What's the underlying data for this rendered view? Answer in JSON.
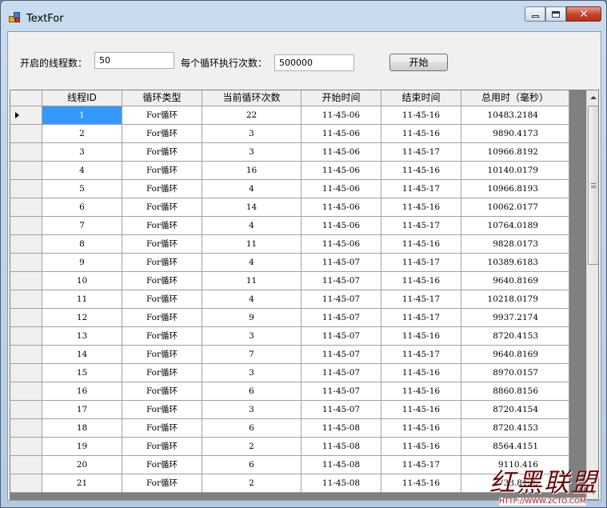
{
  "window": {
    "title": "TextFor"
  },
  "form": {
    "threads_label": "开启的线程数：",
    "threads_value": "50",
    "loops_label": "每个循环执行次数：",
    "loops_value": "500000",
    "start_button": "开始"
  },
  "grid": {
    "columns": [
      "线程ID",
      "循环类型",
      "当前循环次数",
      "开始时间",
      "结束时间",
      "总用时（毫秒）"
    ],
    "rows": [
      [
        "1",
        "For循环",
        "22",
        "11-45-06",
        "11-45-16",
        "10483.2184"
      ],
      [
        "2",
        "For循环",
        "3",
        "11-45-06",
        "11-45-16",
        "9890.4173"
      ],
      [
        "3",
        "For循环",
        "3",
        "11-45-06",
        "11-45-17",
        "10966.8192"
      ],
      [
        "4",
        "For循环",
        "16",
        "11-45-06",
        "11-45-16",
        "10140.0179"
      ],
      [
        "5",
        "For循环",
        "4",
        "11-45-06",
        "11-45-17",
        "10966.8193"
      ],
      [
        "6",
        "For循环",
        "14",
        "11-45-06",
        "11-45-16",
        "10062.0177"
      ],
      [
        "7",
        "For循环",
        "4",
        "11-45-06",
        "11-45-17",
        "10764.0189"
      ],
      [
        "8",
        "For循环",
        "11",
        "11-45-06",
        "11-45-16",
        "9828.0173"
      ],
      [
        "9",
        "For循环",
        "4",
        "11-45-07",
        "11-45-17",
        "10389.6183"
      ],
      [
        "10",
        "For循环",
        "11",
        "11-45-07",
        "11-45-16",
        "9640.8169"
      ],
      [
        "11",
        "For循环",
        "4",
        "11-45-07",
        "11-45-17",
        "10218.0179"
      ],
      [
        "12",
        "For循环",
        "9",
        "11-45-07",
        "11-45-17",
        "9937.2174"
      ],
      [
        "13",
        "For循环",
        "3",
        "11-45-07",
        "11-45-16",
        "8720.4153"
      ],
      [
        "14",
        "For循环",
        "7",
        "11-45-07",
        "11-45-17",
        "9640.8169"
      ],
      [
        "15",
        "For循环",
        "3",
        "11-45-07",
        "11-45-16",
        "8970.0157"
      ],
      [
        "16",
        "For循环",
        "6",
        "11-45-07",
        "11-45-16",
        "8860.8156"
      ],
      [
        "17",
        "For循环",
        "3",
        "11-45-07",
        "11-45-16",
        "8720.4154"
      ],
      [
        "18",
        "For循环",
        "6",
        "11-45-08",
        "11-45-16",
        "8720.4153"
      ],
      [
        "19",
        "For循环",
        "2",
        "11-45-08",
        "11-45-16",
        "8564.4151"
      ],
      [
        "20",
        "For循环",
        "6",
        "11-45-08",
        "11-45-17",
        "9110.416"
      ],
      [
        "21",
        "For循环",
        "2",
        "11-45-08",
        "11-45-16",
        "7738.8136"
      ]
    ],
    "selected_row": 0
  },
  "watermark": {
    "text": "红黑联盟",
    "url": "HTTP://WWW.2CTO.COM"
  },
  "icons": [
    "app-icon",
    "minimize-icon",
    "maximize-icon",
    "close-icon",
    "current-row-arrow-icon",
    "scroll-up-icon",
    "scroll-down-icon",
    "scroll-grip-icon"
  ],
  "colors": {
    "selection": "#3399ff",
    "grid_background": "#808080"
  }
}
